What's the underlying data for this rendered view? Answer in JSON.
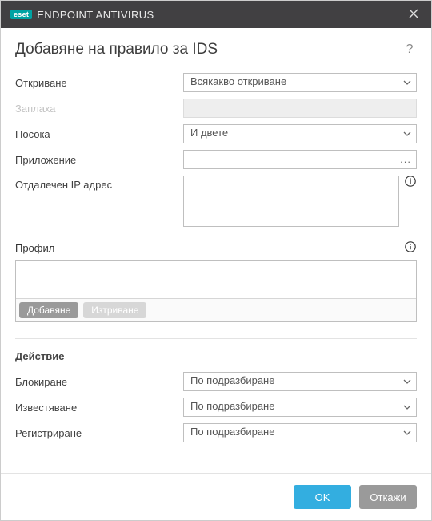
{
  "titlebar": {
    "brand_badge": "eset",
    "app_title": "ENDPOINT ANTIVIRUS"
  },
  "heading": "Добавяне на правило за IDS",
  "form": {
    "detection": {
      "label": "Откриване",
      "value": "Всякакво откриване"
    },
    "threat": {
      "label": "Заплаха"
    },
    "direction": {
      "label": "Посока",
      "value": "И двете"
    },
    "application": {
      "label": "Приложение",
      "value": ""
    },
    "remote_ip": {
      "label": "Отдалечен IP адрес",
      "value": ""
    }
  },
  "profile": {
    "label": "Профил",
    "add_label": "Добавяне",
    "delete_label": "Изтриване"
  },
  "action": {
    "section_title": "Действие",
    "block": {
      "label": "Блокиране",
      "value": "По подразбиране"
    },
    "notify": {
      "label": "Известяване",
      "value": "По подразбиране"
    },
    "log": {
      "label": "Регистриране",
      "value": "По подразбиране"
    }
  },
  "footer": {
    "ok": "OK",
    "cancel": "Откажи"
  }
}
